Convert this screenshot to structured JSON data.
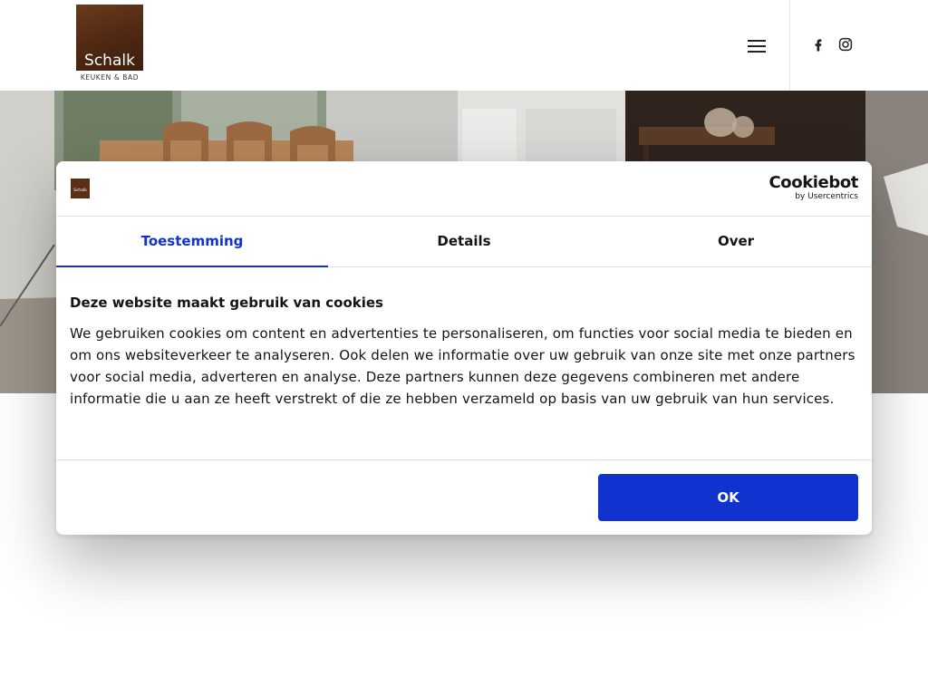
{
  "brand": {
    "logo_name": "Schalk",
    "logo_sub": "KEUKEN & BAD"
  },
  "header": {
    "menu_icon": "hamburger-icon",
    "social": [
      "facebook-icon",
      "instagram-icon"
    ]
  },
  "cookie_dialog": {
    "provider_name": "Cookiebot",
    "provider_sub": "by Usercentrics",
    "dialog_logo_text": "Schalk",
    "tabs": [
      {
        "label": "Toestemming",
        "active": true
      },
      {
        "label": "Details",
        "active": false
      },
      {
        "label": "Over",
        "active": false
      }
    ],
    "title": "Deze website maakt gebruik van cookies",
    "body": "We gebruiken cookies om content en advertenties te personaliseren, om functies voor social media te bieden en om ons websiteverkeer te analyseren. Ook delen we informatie over uw gebruik van onze site met onze partners voor social media, adverteren en analyse. Deze partners kunnen deze gegevens combineren met andere informatie die u aan ze heeft verstrekt of die ze hebben verzameld op basis van uw gebruik van hun services.",
    "ok_label": "OK"
  },
  "colors": {
    "accent": "#1032cf",
    "logo_brown": "#5a2f16",
    "text": "#141414"
  }
}
